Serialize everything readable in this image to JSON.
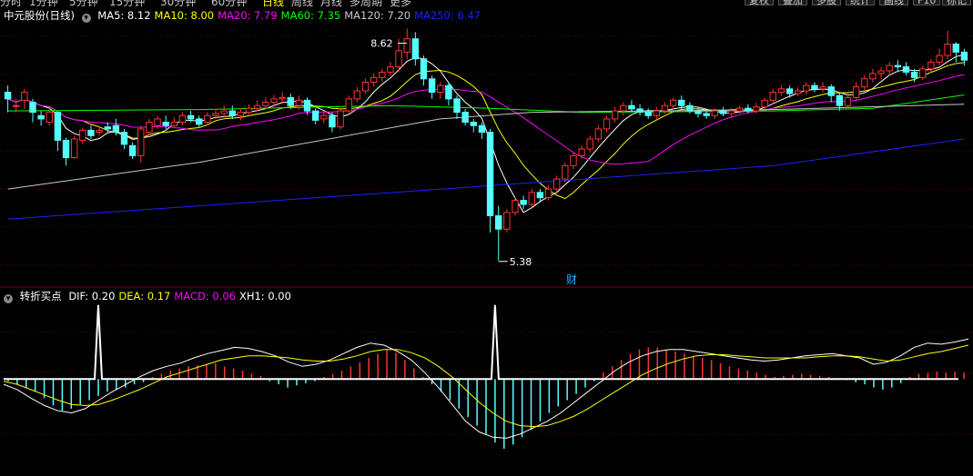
{
  "toolbar": {
    "periods": [
      "分时",
      "1分钟",
      "5分钟",
      "15分钟",
      "30分钟",
      "60分钟",
      "日线",
      "周线",
      "月线",
      "多周期",
      "更多"
    ],
    "buttons": [
      "复权",
      "叠加",
      "多股",
      "统计",
      "画线",
      "F10",
      "标记"
    ],
    "right_icons": [
      "diamond-icon",
      "diamond-icon"
    ]
  },
  "main_panel": {
    "stock_label": "中元股份(日线)",
    "indicators": [
      {
        "label": "MA5: 8.12",
        "color": "#ffffff"
      },
      {
        "label": "MA10: 8.00",
        "color": "#ffff00"
      },
      {
        "label": "MA20: 7.79",
        "color": "#ff00ff"
      },
      {
        "label": "MA60: 7.35",
        "color": "#00ff00"
      },
      {
        "label": "MA120: 7.20",
        "color": "#c8c8c8"
      },
      {
        "label": "MA250: 6.47",
        "color": "#2020ff"
      }
    ],
    "high_label": "8.62",
    "low_label": "5.38",
    "event_marker": "财"
  },
  "sub_panel": {
    "title": "转折买点",
    "indicators": [
      {
        "label": "DIF: 0.20",
        "color": "#ffffff"
      },
      {
        "label": "DEA: 0.17",
        "color": "#ffff00"
      },
      {
        "label": "MACD: 0.06",
        "color": "#ff00ff"
      },
      {
        "label": "XH1: 0.00",
        "color": "#ffffff"
      }
    ]
  },
  "colors": {
    "up": "#ff3333",
    "down": "#54ffff",
    "grid": "#7a0000",
    "bg": "#000000"
  },
  "chart_data": [
    {
      "type": "candlestick",
      "ylim": [
        5.2,
        8.9
      ],
      "grid": true,
      "candles": [
        [
          7.9,
          7.8,
          8.0,
          7.6
        ],
        [
          7.7,
          7.7,
          7.8,
          7.6
        ],
        [
          7.78,
          7.9,
          7.95,
          7.65
        ],
        [
          7.75,
          7.6,
          7.8,
          7.45
        ],
        [
          7.55,
          7.5,
          7.62,
          7.4
        ],
        [
          7.45,
          7.6,
          7.68,
          7.4
        ],
        [
          7.6,
          7.18,
          7.6,
          7.02
        ],
        [
          7.18,
          6.92,
          7.22,
          6.8
        ],
        [
          6.92,
          7.2,
          7.25,
          6.9
        ],
        [
          7.18,
          7.33,
          7.37,
          7.12
        ],
        [
          7.33,
          7.25,
          7.4,
          7.2
        ],
        [
          7.3,
          7.33,
          7.4,
          7.25
        ],
        [
          7.38,
          7.35,
          7.45,
          7.3
        ],
        [
          7.4,
          7.3,
          7.5,
          7.25
        ],
        [
          7.3,
          7.12,
          7.35,
          7.05
        ],
        [
          7.1,
          6.95,
          7.15,
          6.9
        ],
        [
          6.95,
          7.35,
          7.4,
          6.85
        ],
        [
          7.3,
          7.45,
          7.5,
          7.25
        ],
        [
          7.4,
          7.5,
          7.55,
          7.35
        ],
        [
          7.45,
          7.4,
          7.55,
          7.35
        ],
        [
          7.4,
          7.45,
          7.52,
          7.36
        ],
        [
          7.45,
          7.55,
          7.6,
          7.4
        ],
        [
          7.55,
          7.5,
          7.62,
          7.45
        ],
        [
          7.5,
          7.42,
          7.55,
          7.38
        ],
        [
          7.45,
          7.55,
          7.6,
          7.4
        ],
        [
          7.55,
          7.58,
          7.65,
          7.5
        ],
        [
          7.58,
          7.62,
          7.7,
          7.52
        ],
        [
          7.62,
          7.55,
          7.7,
          7.5
        ],
        [
          7.55,
          7.6,
          7.66,
          7.48
        ],
        [
          7.6,
          7.66,
          7.72,
          7.54
        ],
        [
          7.66,
          7.7,
          7.78,
          7.62
        ],
        [
          7.7,
          7.75,
          7.82,
          7.64
        ],
        [
          7.75,
          7.8,
          7.86,
          7.68
        ],
        [
          7.8,
          7.82,
          7.9,
          7.72
        ],
        [
          7.82,
          7.7,
          7.88,
          7.65
        ],
        [
          7.7,
          7.78,
          7.85,
          7.64
        ],
        [
          7.78,
          7.62,
          7.82,
          7.56
        ],
        [
          7.62,
          7.48,
          7.66,
          7.42
        ],
        [
          7.5,
          7.55,
          7.6,
          7.44
        ],
        [
          7.55,
          7.38,
          7.6,
          7.3
        ],
        [
          7.38,
          7.62,
          7.66,
          7.34
        ],
        [
          7.62,
          7.8,
          7.85,
          7.58
        ],
        [
          7.8,
          7.92,
          7.98,
          7.75
        ],
        [
          7.92,
          8.05,
          8.1,
          7.88
        ],
        [
          8.05,
          8.12,
          8.18,
          7.98
        ],
        [
          8.12,
          8.2,
          8.25,
          8.06
        ],
        [
          8.2,
          8.28,
          8.35,
          8.14
        ],
        [
          8.28,
          8.52,
          8.7,
          8.2
        ],
        [
          8.5,
          8.7,
          8.85,
          8.4
        ],
        [
          8.7,
          8.4,
          8.8,
          8.3
        ],
        [
          8.4,
          8.1,
          8.45,
          8.0
        ],
        [
          8.1,
          7.9,
          8.15,
          7.8
        ],
        [
          7.9,
          8.0,
          8.05,
          7.8
        ],
        [
          8.0,
          7.8,
          8.05,
          7.7
        ],
        [
          7.8,
          7.6,
          7.85,
          7.5
        ],
        [
          7.6,
          7.45,
          7.65,
          7.4
        ],
        [
          7.45,
          7.4,
          7.5,
          7.3
        ],
        [
          7.4,
          7.3,
          7.45,
          7.2
        ],
        [
          7.3,
          6.05,
          7.35,
          5.8
        ],
        [
          6.05,
          5.85,
          6.2,
          5.38
        ],
        [
          5.85,
          6.1,
          6.15,
          5.8
        ],
        [
          6.1,
          6.28,
          6.32,
          6.05
        ],
        [
          6.28,
          6.22,
          6.35,
          6.15
        ],
        [
          6.22,
          6.4,
          6.45,
          6.18
        ],
        [
          6.4,
          6.32,
          6.45,
          6.25
        ],
        [
          6.32,
          6.45,
          6.5,
          6.28
        ],
        [
          6.45,
          6.6,
          6.65,
          6.4
        ],
        [
          6.6,
          6.8,
          6.85,
          6.55
        ],
        [
          6.8,
          6.95,
          7.0,
          6.75
        ],
        [
          6.95,
          7.05,
          7.1,
          6.9
        ],
        [
          7.05,
          7.2,
          7.25,
          7.0
        ],
        [
          7.2,
          7.35,
          7.4,
          7.15
        ],
        [
          7.35,
          7.5,
          7.55,
          7.3
        ],
        [
          7.5,
          7.62,
          7.68,
          7.45
        ],
        [
          7.62,
          7.7,
          7.75,
          7.55
        ],
        [
          7.7,
          7.65,
          7.78,
          7.6
        ],
        [
          7.65,
          7.6,
          7.72,
          7.55
        ],
        [
          7.6,
          7.55,
          7.66,
          7.5
        ],
        [
          7.55,
          7.62,
          7.68,
          7.5
        ],
        [
          7.62,
          7.7,
          7.75,
          7.58
        ],
        [
          7.7,
          7.78,
          7.82,
          7.65
        ],
        [
          7.78,
          7.7,
          7.85,
          7.65
        ],
        [
          7.7,
          7.62,
          7.75,
          7.58
        ],
        [
          7.62,
          7.58,
          7.68,
          7.52
        ],
        [
          7.58,
          7.55,
          7.62,
          7.5
        ],
        [
          7.55,
          7.62,
          7.66,
          7.5
        ],
        [
          7.62,
          7.58,
          7.68,
          7.54
        ],
        [
          7.58,
          7.62,
          7.66,
          7.52
        ],
        [
          7.62,
          7.66,
          7.7,
          7.58
        ],
        [
          7.66,
          7.62,
          7.72,
          7.58
        ],
        [
          7.62,
          7.68,
          7.74,
          7.58
        ],
        [
          7.68,
          7.78,
          7.82,
          7.64
        ],
        [
          7.78,
          7.9,
          7.95,
          7.72
        ],
        [
          7.9,
          7.95,
          8.0,
          7.85
        ],
        [
          7.95,
          7.88,
          8.0,
          7.82
        ],
        [
          7.88,
          7.92,
          7.98,
          7.84
        ],
        [
          7.92,
          8.0,
          8.05,
          7.86
        ],
        [
          8.0,
          7.95,
          8.05,
          7.9
        ],
        [
          7.95,
          7.98,
          8.05,
          7.9
        ],
        [
          7.98,
          7.85,
          8.02,
          7.75
        ],
        [
          7.85,
          7.7,
          7.9,
          7.62
        ],
        [
          7.7,
          7.82,
          7.88,
          7.65
        ],
        [
          7.82,
          7.98,
          8.05,
          7.78
        ],
        [
          7.98,
          8.1,
          8.15,
          7.92
        ],
        [
          8.1,
          8.18,
          8.25,
          8.05
        ],
        [
          8.18,
          8.22,
          8.28,
          8.1
        ],
        [
          8.22,
          8.3,
          8.35,
          8.15
        ],
        [
          8.3,
          8.28,
          8.38,
          8.2
        ],
        [
          8.28,
          8.2,
          8.35,
          8.15
        ],
        [
          8.2,
          8.12,
          8.25,
          8.05
        ],
        [
          8.12,
          8.25,
          8.3,
          8.08
        ],
        [
          8.25,
          8.35,
          8.4,
          8.2
        ],
        [
          8.35,
          8.45,
          8.55,
          8.3
        ],
        [
          8.45,
          8.62,
          8.82,
          8.4
        ],
        [
          8.62,
          8.5,
          8.65,
          8.35
        ],
        [
          8.5,
          8.38,
          8.55,
          8.3
        ]
      ],
      "high_label": 8.62,
      "low_label": 5.38
    },
    {
      "type": "macd",
      "ylim": [
        -0.9,
        0.75
      ],
      "grid": true,
      "macd_bars": [
        -0.02,
        -0.05,
        -0.08,
        -0.12,
        -0.18,
        -0.25,
        -0.3,
        -0.28,
        -0.24,
        -0.2,
        -0.16,
        -0.12,
        -0.1,
        -0.08,
        -0.05,
        -0.03,
        0.02,
        0.05,
        0.08,
        0.1,
        0.12,
        0.13,
        0.14,
        0.15,
        0.12,
        0.1,
        0.08,
        0.05,
        0.03,
        -0.02,
        -0.05,
        -0.08,
        -0.06,
        -0.04,
        -0.02,
        0.02,
        0.05,
        0.08,
        0.12,
        0.16,
        0.2,
        0.24,
        0.28,
        0.25,
        0.18,
        0.1,
        0.02,
        -0.05,
        -0.12,
        -0.2,
        -0.28,
        -0.36,
        -0.44,
        -0.52,
        -0.6,
        -0.66,
        -0.62,
        -0.55,
        -0.48,
        -0.4,
        -0.32,
        -0.26,
        -0.2,
        -0.14,
        -0.08,
        -0.02,
        0.06,
        0.12,
        0.18,
        0.24,
        0.28,
        0.3,
        0.3,
        0.28,
        0.26,
        0.24,
        0.22,
        0.2,
        0.18,
        0.15,
        0.12,
        0.1,
        0.08,
        0.06,
        0.04,
        0.02,
        0.03,
        0.04,
        0.05,
        0.04,
        0.03,
        0.02,
        0.01,
        -0.01,
        -0.03,
        -0.05,
        -0.08,
        -0.1,
        -0.08,
        -0.04,
        0.02,
        0.05,
        0.06,
        0.07,
        0.06,
        0.07,
        0.06
      ],
      "dif": [
        -0.05,
        -0.1,
        -0.18,
        -0.25,
        -0.3,
        -0.32,
        -0.28,
        -0.2,
        -0.12,
        -0.05,
        0.02,
        0.08,
        0.12,
        0.15,
        0.2,
        0.24,
        0.27,
        0.3,
        0.29,
        0.26,
        0.22,
        0.16,
        0.12,
        0.14,
        0.18,
        0.24,
        0.3,
        0.34,
        0.32,
        0.26,
        0.18,
        0.06,
        -0.08,
        -0.24,
        -0.4,
        -0.5,
        -0.55,
        -0.56,
        -0.52,
        -0.46,
        -0.4,
        -0.32,
        -0.22,
        -0.12,
        -0.02,
        0.08,
        0.16,
        0.22,
        0.26,
        0.28,
        0.28,
        0.26,
        0.24,
        0.22,
        0.2,
        0.18,
        0.17,
        0.18,
        0.2,
        0.22,
        0.23,
        0.24,
        0.22,
        0.2,
        0.14,
        0.16,
        0.22,
        0.3,
        0.34,
        0.33,
        0.35,
        0.38
      ],
      "dea": [
        -0.02,
        -0.05,
        -0.1,
        -0.15,
        -0.2,
        -0.24,
        -0.25,
        -0.24,
        -0.2,
        -0.15,
        -0.1,
        -0.04,
        0.02,
        0.06,
        0.1,
        0.14,
        0.18,
        0.2,
        0.22,
        0.22,
        0.21,
        0.2,
        0.18,
        0.17,
        0.17,
        0.19,
        0.22,
        0.26,
        0.28,
        0.28,
        0.25,
        0.2,
        0.12,
        0.02,
        -0.1,
        -0.22,
        -0.32,
        -0.4,
        -0.44,
        -0.45,
        -0.44,
        -0.4,
        -0.35,
        -0.28,
        -0.2,
        -0.12,
        -0.04,
        0.04,
        0.1,
        0.15,
        0.19,
        0.22,
        0.23,
        0.23,
        0.22,
        0.21,
        0.2,
        0.2,
        0.2,
        0.2,
        0.21,
        0.22,
        0.22,
        0.21,
        0.19,
        0.17,
        0.18,
        0.21,
        0.24,
        0.26,
        0.29,
        0.32
      ],
      "xh1_signals_at_index": [
        10,
        54
      ],
      "xh1_value": 0.0
    }
  ]
}
